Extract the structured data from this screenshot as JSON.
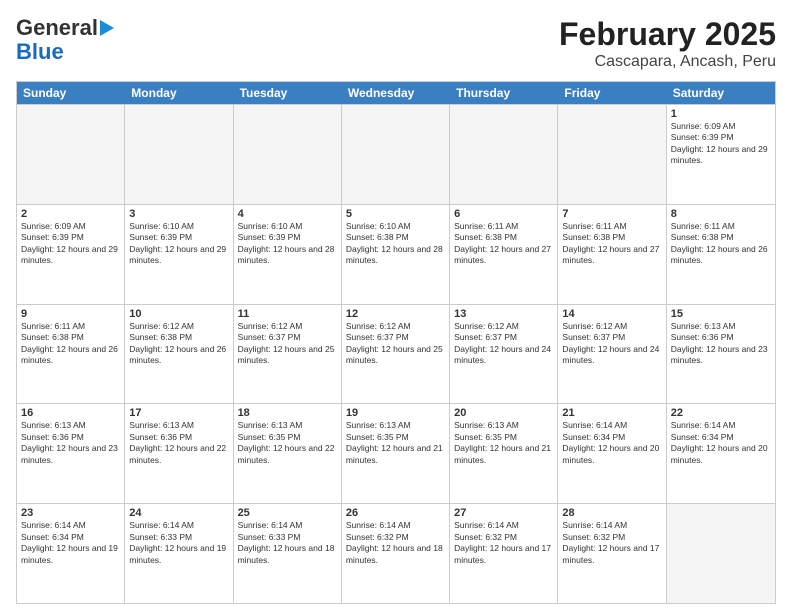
{
  "header": {
    "logo_general": "General",
    "logo_blue": "Blue",
    "title": "February 2025",
    "subtitle": "Cascapara, Ancash, Peru"
  },
  "days_of_week": [
    "Sunday",
    "Monday",
    "Tuesday",
    "Wednesday",
    "Thursday",
    "Friday",
    "Saturday"
  ],
  "weeks": [
    [
      {
        "num": "",
        "info": ""
      },
      {
        "num": "",
        "info": ""
      },
      {
        "num": "",
        "info": ""
      },
      {
        "num": "",
        "info": ""
      },
      {
        "num": "",
        "info": ""
      },
      {
        "num": "",
        "info": ""
      },
      {
        "num": "1",
        "info": "Sunrise: 6:09 AM\nSunset: 6:39 PM\nDaylight: 12 hours and 29 minutes."
      }
    ],
    [
      {
        "num": "2",
        "info": "Sunrise: 6:09 AM\nSunset: 6:39 PM\nDaylight: 12 hours and 29 minutes."
      },
      {
        "num": "3",
        "info": "Sunrise: 6:10 AM\nSunset: 6:39 PM\nDaylight: 12 hours and 29 minutes."
      },
      {
        "num": "4",
        "info": "Sunrise: 6:10 AM\nSunset: 6:39 PM\nDaylight: 12 hours and 28 minutes."
      },
      {
        "num": "5",
        "info": "Sunrise: 6:10 AM\nSunset: 6:38 PM\nDaylight: 12 hours and 28 minutes."
      },
      {
        "num": "6",
        "info": "Sunrise: 6:11 AM\nSunset: 6:38 PM\nDaylight: 12 hours and 27 minutes."
      },
      {
        "num": "7",
        "info": "Sunrise: 6:11 AM\nSunset: 6:38 PM\nDaylight: 12 hours and 27 minutes."
      },
      {
        "num": "8",
        "info": "Sunrise: 6:11 AM\nSunset: 6:38 PM\nDaylight: 12 hours and 26 minutes."
      }
    ],
    [
      {
        "num": "9",
        "info": "Sunrise: 6:11 AM\nSunset: 6:38 PM\nDaylight: 12 hours and 26 minutes."
      },
      {
        "num": "10",
        "info": "Sunrise: 6:12 AM\nSunset: 6:38 PM\nDaylight: 12 hours and 26 minutes."
      },
      {
        "num": "11",
        "info": "Sunrise: 6:12 AM\nSunset: 6:37 PM\nDaylight: 12 hours and 25 minutes."
      },
      {
        "num": "12",
        "info": "Sunrise: 6:12 AM\nSunset: 6:37 PM\nDaylight: 12 hours and 25 minutes."
      },
      {
        "num": "13",
        "info": "Sunrise: 6:12 AM\nSunset: 6:37 PM\nDaylight: 12 hours and 24 minutes."
      },
      {
        "num": "14",
        "info": "Sunrise: 6:12 AM\nSunset: 6:37 PM\nDaylight: 12 hours and 24 minutes."
      },
      {
        "num": "15",
        "info": "Sunrise: 6:13 AM\nSunset: 6:36 PM\nDaylight: 12 hours and 23 minutes."
      }
    ],
    [
      {
        "num": "16",
        "info": "Sunrise: 6:13 AM\nSunset: 6:36 PM\nDaylight: 12 hours and 23 minutes."
      },
      {
        "num": "17",
        "info": "Sunrise: 6:13 AM\nSunset: 6:36 PM\nDaylight: 12 hours and 22 minutes."
      },
      {
        "num": "18",
        "info": "Sunrise: 6:13 AM\nSunset: 6:35 PM\nDaylight: 12 hours and 22 minutes."
      },
      {
        "num": "19",
        "info": "Sunrise: 6:13 AM\nSunset: 6:35 PM\nDaylight: 12 hours and 21 minutes."
      },
      {
        "num": "20",
        "info": "Sunrise: 6:13 AM\nSunset: 6:35 PM\nDaylight: 12 hours and 21 minutes."
      },
      {
        "num": "21",
        "info": "Sunrise: 6:14 AM\nSunset: 6:34 PM\nDaylight: 12 hours and 20 minutes."
      },
      {
        "num": "22",
        "info": "Sunrise: 6:14 AM\nSunset: 6:34 PM\nDaylight: 12 hours and 20 minutes."
      }
    ],
    [
      {
        "num": "23",
        "info": "Sunrise: 6:14 AM\nSunset: 6:34 PM\nDaylight: 12 hours and 19 minutes."
      },
      {
        "num": "24",
        "info": "Sunrise: 6:14 AM\nSunset: 6:33 PM\nDaylight: 12 hours and 19 minutes."
      },
      {
        "num": "25",
        "info": "Sunrise: 6:14 AM\nSunset: 6:33 PM\nDaylight: 12 hours and 18 minutes."
      },
      {
        "num": "26",
        "info": "Sunrise: 6:14 AM\nSunset: 6:32 PM\nDaylight: 12 hours and 18 minutes."
      },
      {
        "num": "27",
        "info": "Sunrise: 6:14 AM\nSunset: 6:32 PM\nDaylight: 12 hours and 17 minutes."
      },
      {
        "num": "28",
        "info": "Sunrise: 6:14 AM\nSunset: 6:32 PM\nDaylight: 12 hours and 17 minutes."
      },
      {
        "num": "",
        "info": ""
      }
    ]
  ]
}
